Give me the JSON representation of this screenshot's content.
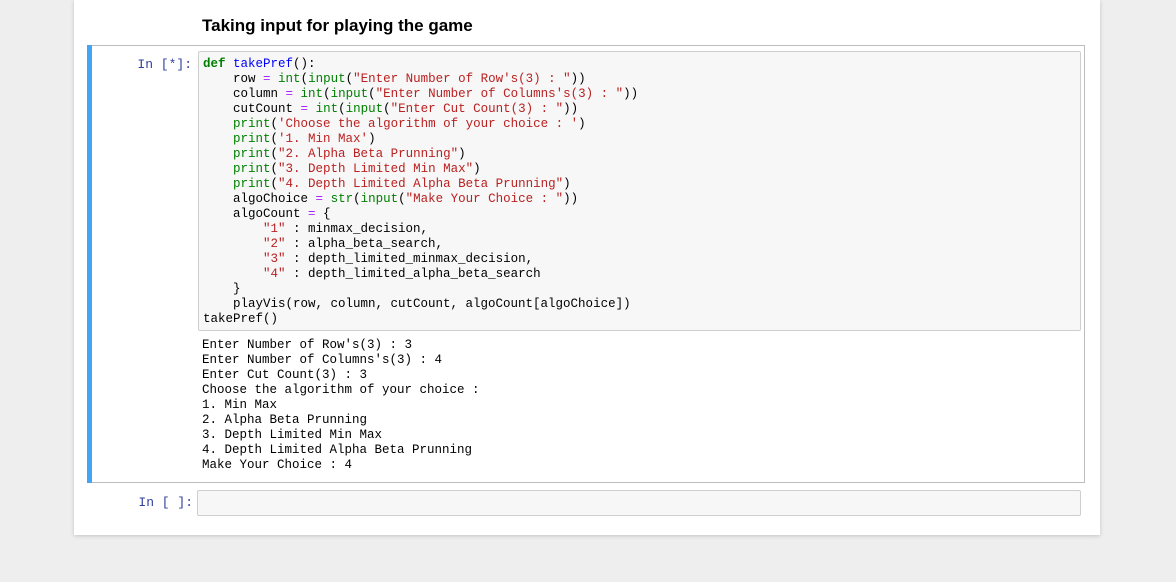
{
  "markdown": {
    "heading": "Taking input for playing the game"
  },
  "code_cell": {
    "prompt": "In [*]:",
    "source_lines": [
      "def takePref():",
      "    row = int(input(\"Enter Number of Row's(3) : \"))",
      "    column = int(input(\"Enter Number of Columns's(3) : \"))",
      "    cutCount = int(input(\"Enter Cut Count(3) : \"))",
      "    print('Choose the algorithm of your choice : ')",
      "    print('1. Min Max')",
      "    print(\"2. Alpha Beta Prunning\")",
      "    print(\"3. Depth Limited Min Max\")",
      "    print(\"4. Depth Limited Alpha Beta Prunning\")",
      "    algoChoice = str(input(\"Make Your Choice : \"))",
      "    algoCount = {",
      "        \"1\" : minmax_decision,",
      "        \"2\" : alpha_beta_search,",
      "        \"3\" : depth_limited_minmax_decision,",
      "        \"4\" : depth_limited_alpha_beta_search",
      "    }",
      "    playVis(row, column, cutCount, algoCount[algoChoice])",
      "takePref()"
    ],
    "output_lines": [
      "Enter Number of Row's(3) : 3",
      "Enter Number of Columns's(3) : 4",
      "Enter Cut Count(3) : 3",
      "Choose the algorithm of your choice : ",
      "1. Min Max",
      "2. Alpha Beta Prunning",
      "3. Depth Limited Min Max",
      "4. Depth Limited Alpha Beta Prunning",
      "Make Your Choice : 4"
    ]
  },
  "empty_cell": {
    "prompt": "In [ ]:"
  },
  "colors": {
    "selected_cell_bar": "#42a5f5",
    "prompt": "#303f9f",
    "keyword": "#008000",
    "function_name": "#0000ff",
    "operator": "#aa22ff",
    "string": "#ba2121"
  }
}
